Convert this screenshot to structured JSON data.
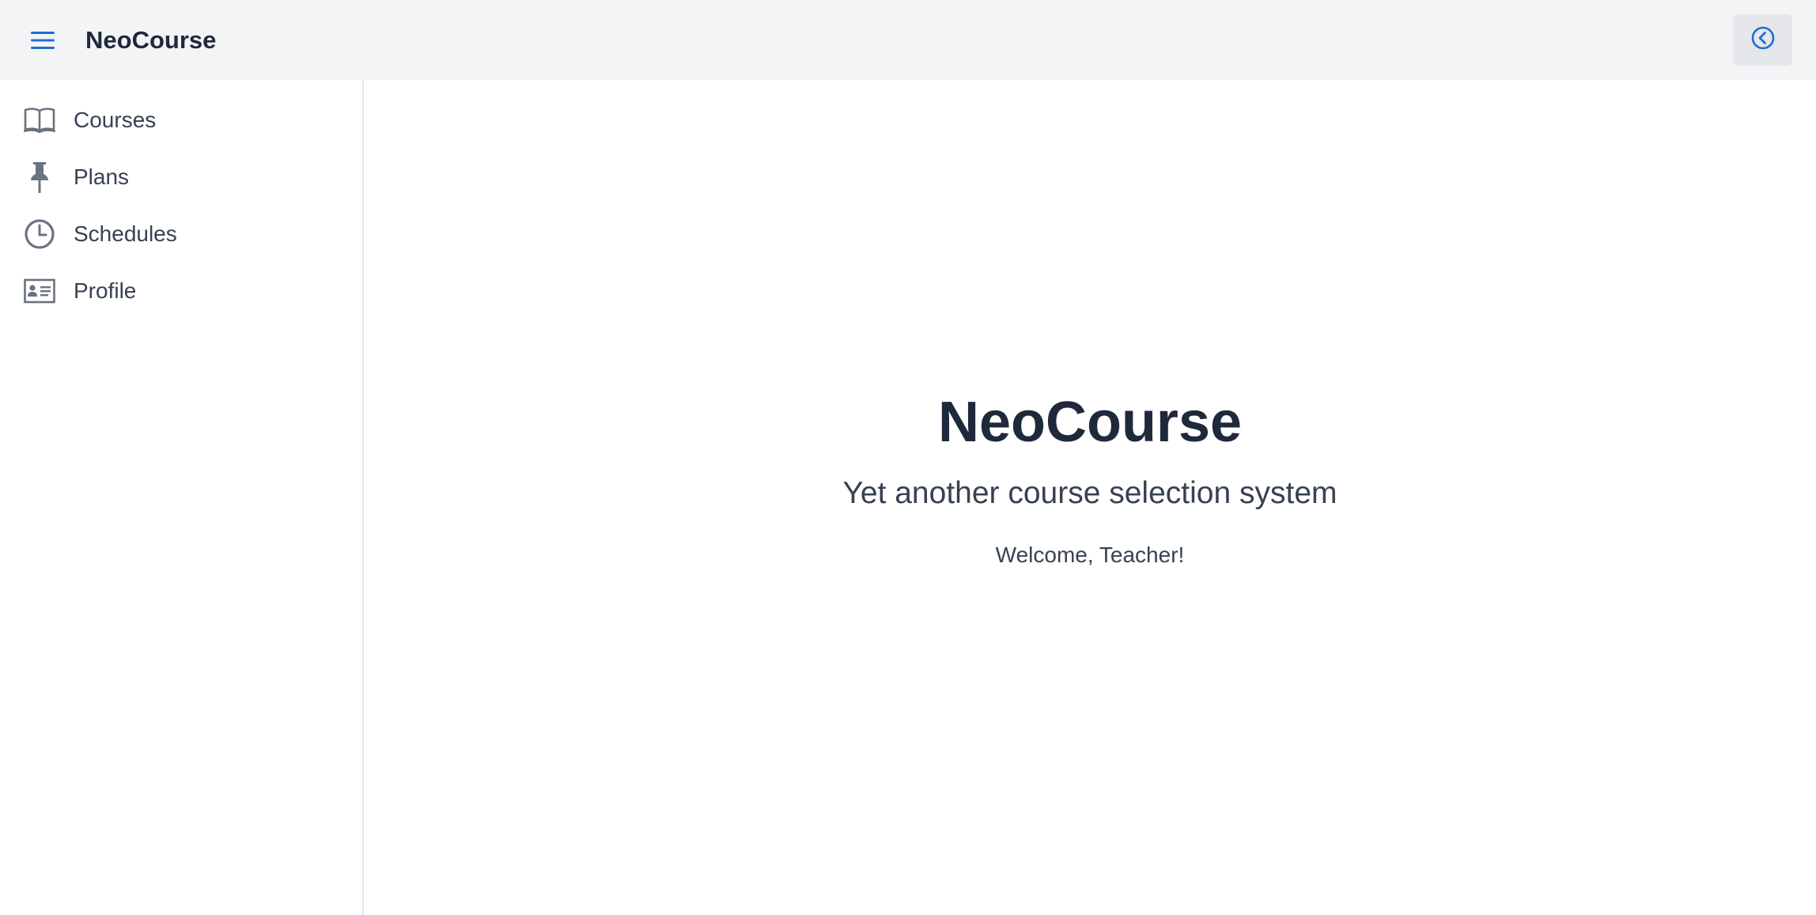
{
  "header": {
    "menu_icon": "hamburger-menu-icon",
    "title": "NeoCourse",
    "collapse_icon": "chevron-left-circle-icon"
  },
  "sidebar": {
    "items": [
      {
        "label": "Courses",
        "icon": "book-open-icon"
      },
      {
        "label": "Plans",
        "icon": "pushpin-icon"
      },
      {
        "label": "Schedules",
        "icon": "clock-icon"
      },
      {
        "label": "Profile",
        "icon": "id-card-icon"
      }
    ]
  },
  "main": {
    "title": "NeoCourse",
    "subtitle": "Yet another course selection system",
    "welcome": "Welcome, Teacher!"
  },
  "colors": {
    "accent": "#1e6fd1",
    "header_bg": "#f3f4f6",
    "icon_gray": "#6b7280",
    "text_dark": "#1e293b"
  }
}
